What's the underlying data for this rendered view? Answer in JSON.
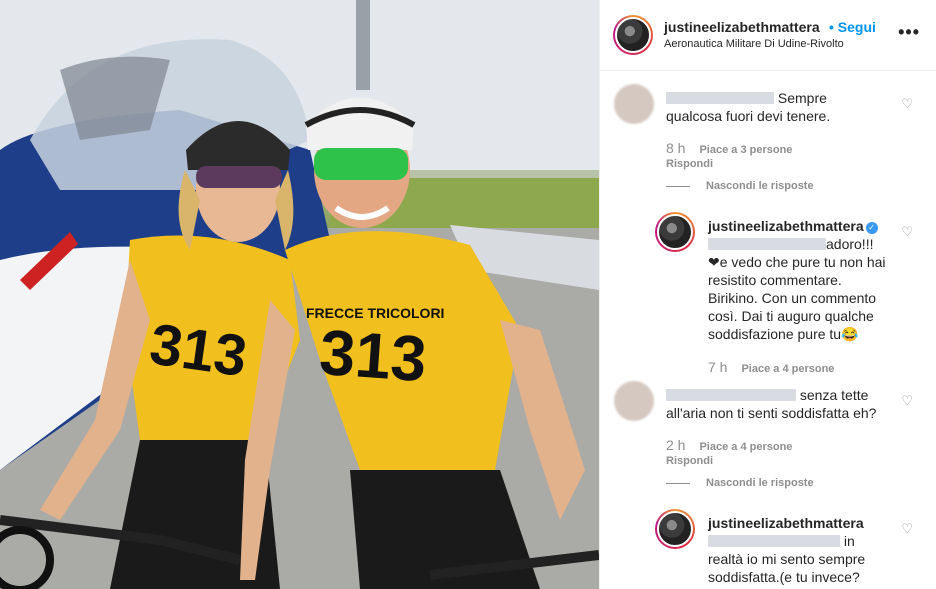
{
  "header": {
    "username": "justineelizabethmattera",
    "follow_label": "• Segui",
    "location": "Aeronautica Militare Di Udine-Rivolto",
    "more_label": "•••"
  },
  "comments": [
    {
      "text_after_blur": "Sempre",
      "text_rest": "qualcosa fuori devi tenere.",
      "time": "8 h",
      "likes": "Piace a 3 persone",
      "reply": "Rispondi",
      "hide": "Nascondi le risposte"
    },
    {
      "username": "justineelizabethmattera",
      "text_after_blur": "adoro!!!",
      "text_rest": "❤e vedo che pure tu non hai resistito commentare. Birikino. Con un commento così. Dai ti auguro qualche soddisfazione pure tu😂",
      "time": "7 h",
      "likes": "Piace a 4 persone"
    },
    {
      "text_after_blur": "senza tette",
      "text_rest": "all'aria non ti senti soddisfatta eh?",
      "time": "2 h",
      "likes": "Piace a 4 persone",
      "reply": "Rispondi",
      "hide": "Nascondi le risposte"
    },
    {
      "username": "justineelizabethmattera",
      "text_after_blur": "in",
      "text_rest": "realtà io mi sento sempre soddisfatta.(e tu invece?"
    }
  ],
  "photo": {
    "jersey_left_number": "313",
    "jersey_right_number": "313",
    "jersey_text": "FRECCE TRICOLORI"
  },
  "icons": {
    "heart": "heart-outline-icon",
    "verified": "verified-badge-icon",
    "more": "more-options-icon"
  },
  "colors": {
    "accent": "#0095f6",
    "verified": "#3897f0",
    "jersey_yellow": "#f2c01e"
  }
}
